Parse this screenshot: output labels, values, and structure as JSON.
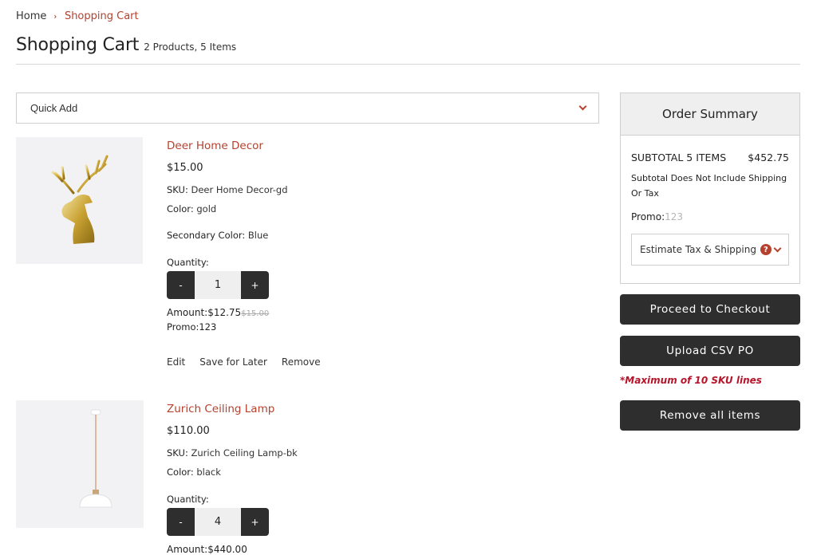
{
  "breadcrumb": {
    "home": "Home",
    "separator": "›",
    "current": "Shopping Cart"
  },
  "header": {
    "title": "Shopping Cart",
    "subtitle": "2 Products, 5 Items"
  },
  "quick_add": {
    "label": "Quick Add",
    "icon": "chevron-down-icon"
  },
  "products": [
    {
      "name": "Deer Home Decor",
      "price": "$15.00",
      "sku_label": "SKU:",
      "sku": "Deer Home Decor-gd",
      "color_label": "Color:",
      "color": "gold",
      "secondary_color_label": "Secondary Color:",
      "secondary_color": "Blue",
      "quantity_label": "Quantity:",
      "quantity": "1",
      "minus": "-",
      "plus": "+",
      "amount_label": "Amount:",
      "amount": "$12.75",
      "original_amount": "$15.00",
      "promo_label": "Promo:",
      "promo": "123",
      "actions": {
        "edit": "Edit",
        "save_for_later": "Save for Later",
        "remove": "Remove"
      }
    },
    {
      "name": "Zurich Ceiling Lamp",
      "price": "$110.00",
      "sku_label": "SKU:",
      "sku": "Zurich Ceiling Lamp-bk",
      "color_label": "Color:",
      "color": "black",
      "quantity_label": "Quantity:",
      "quantity": "4",
      "minus": "-",
      "plus": "+",
      "amount_label": "Amount:",
      "amount": "$440.00"
    }
  ],
  "summary": {
    "title": "Order Summary",
    "subtotal_label": "SUBTOTAL 5 ITEMS",
    "subtotal": "$452.75",
    "note": "Subtotal Does Not Include Shipping Or Tax",
    "promo_label": "Promo:",
    "promo_code": "123",
    "estimate_label": "Estimate Tax & Shipping",
    "help_icon": "?"
  },
  "buttons": {
    "checkout": "Proceed to Checkout",
    "upload_csv": "Upload CSV PO",
    "max_note": "*Maximum of 10 SKU lines",
    "remove_all": "Remove all items"
  },
  "colors": {
    "accent": "#b5412e",
    "button_dark": "#2e2e2e",
    "warning": "#b5152b"
  }
}
